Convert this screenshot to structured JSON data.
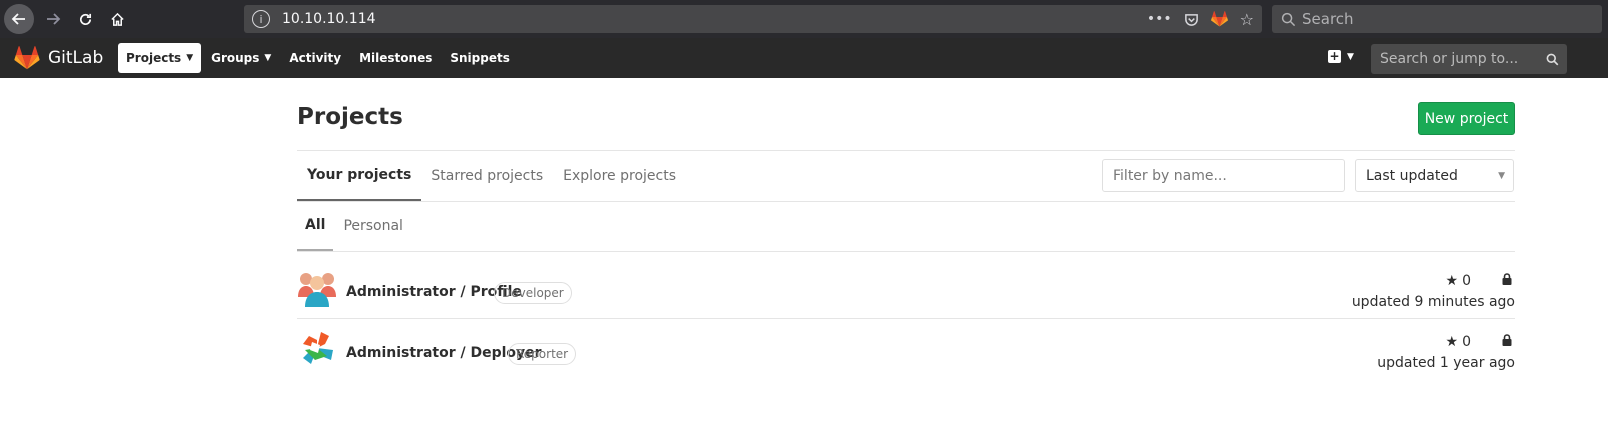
{
  "browser": {
    "url": "10.10.10.114",
    "search_placeholder": "Search"
  },
  "header": {
    "brand": "GitLab",
    "nav": [
      {
        "label": "Projects"
      },
      {
        "label": "Groups"
      },
      {
        "label": "Activity"
      },
      {
        "label": "Milestones"
      },
      {
        "label": "Snippets"
      }
    ],
    "search_placeholder": "Search or jump to..."
  },
  "page": {
    "title": "Projects",
    "new_project_label": "New project",
    "tabs": [
      {
        "label": "Your projects"
      },
      {
        "label": "Starred projects"
      },
      {
        "label": "Explore projects"
      }
    ],
    "filter_placeholder": "Filter by name...",
    "sort_selected": "Last updated",
    "subtabs": [
      {
        "label": "All"
      },
      {
        "label": "Personal"
      }
    ]
  },
  "projects": [
    {
      "name": "Administrator / Profile",
      "role": "Developer",
      "stars": "0",
      "updated": "updated 9 minutes ago"
    },
    {
      "name": "Administrator / Deployer",
      "role": "Reporter",
      "stars": "0",
      "updated": "updated 1 year ago"
    }
  ],
  "colors": {
    "header_bg": "#292929",
    "primary_green": "#1aaa55",
    "browser_bg": "#2a2a2e"
  }
}
